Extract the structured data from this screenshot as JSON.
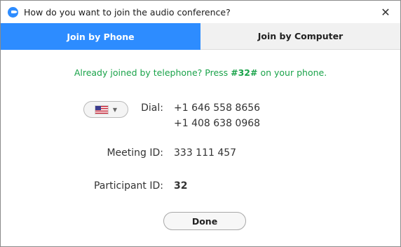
{
  "window": {
    "title": "How do you want to join the audio conference?"
  },
  "tabs": [
    {
      "label": "Join by Phone",
      "active": true
    },
    {
      "label": "Join by Computer",
      "active": false
    }
  ],
  "notice": {
    "prefix": "Already joined by telephone? Press ",
    "code": "#32#",
    "suffix": " on your phone."
  },
  "dial": {
    "country": "United States",
    "label": "Dial:",
    "numbers": [
      "+1 646 558 8656",
      "+1 408 638 0968"
    ]
  },
  "meeting": {
    "label": "Meeting ID:",
    "value": "333 111 457"
  },
  "participant": {
    "label": "Participant ID:",
    "value": "32"
  },
  "done": {
    "label": "Done"
  },
  "colors": {
    "accent": "#2d8cff",
    "success": "#1aa34a"
  },
  "icons": {
    "app": "zoom-camera-icon",
    "close": "close-icon",
    "flag": "us-flag-icon",
    "dropdown": "chevron-down-icon"
  }
}
